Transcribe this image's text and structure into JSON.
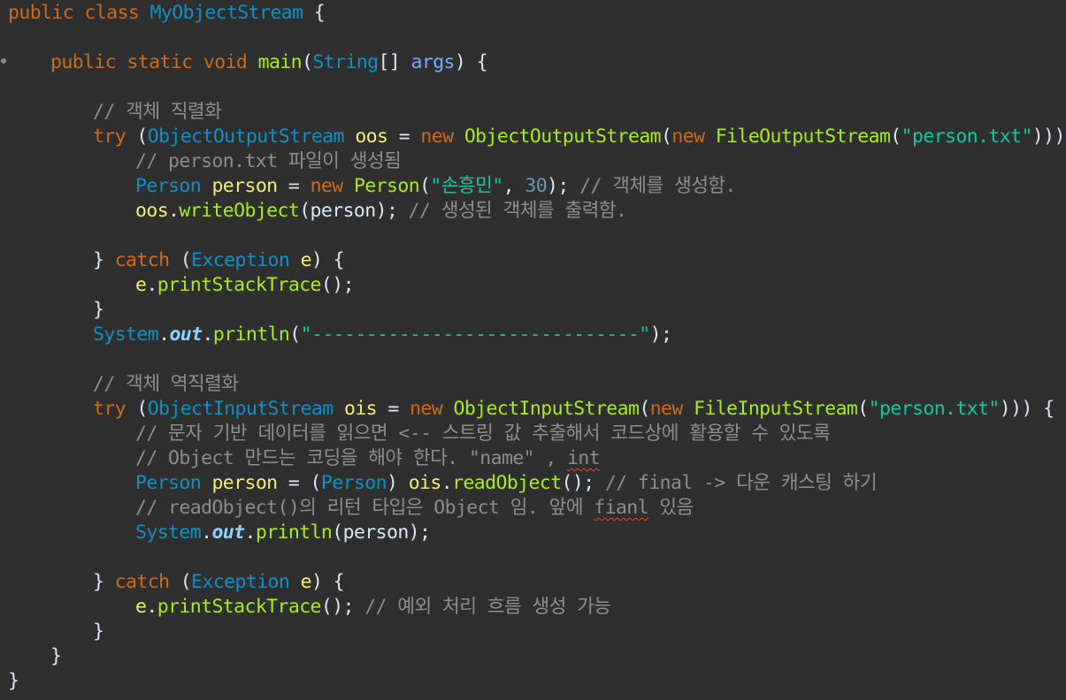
{
  "editor": {
    "lines": [
      {
        "indent": 0,
        "tokens": [
          {
            "t": "public",
            "c": "kw"
          },
          {
            "t": " ",
            "c": "plain"
          },
          {
            "t": "class",
            "c": "kw"
          },
          {
            "t": " ",
            "c": "plain"
          },
          {
            "t": "MyObjectStream",
            "c": "cls"
          },
          {
            "t": " {",
            "c": "plain"
          }
        ]
      },
      {
        "indent": 0,
        "tokens": []
      },
      {
        "indent": 1,
        "tokens": [
          {
            "t": "public",
            "c": "kw"
          },
          {
            "t": " ",
            "c": "plain"
          },
          {
            "t": "static",
            "c": "kw"
          },
          {
            "t": " ",
            "c": "plain"
          },
          {
            "t": "void",
            "c": "kw"
          },
          {
            "t": " ",
            "c": "plain"
          },
          {
            "t": "main",
            "c": "method"
          },
          {
            "t": "(",
            "c": "plain"
          },
          {
            "t": "String",
            "c": "cls"
          },
          {
            "t": "[] ",
            "c": "plain"
          },
          {
            "t": "args",
            "c": "param"
          },
          {
            "t": ") {",
            "c": "plain"
          }
        ]
      },
      {
        "indent": 0,
        "tokens": []
      },
      {
        "indent": 2,
        "tokens": [
          {
            "t": "// 객체 직렬화",
            "c": "com"
          }
        ]
      },
      {
        "indent": 2,
        "tokens": [
          {
            "t": "try",
            "c": "kw"
          },
          {
            "t": " (",
            "c": "plain"
          },
          {
            "t": "ObjectOutputStream",
            "c": "cls"
          },
          {
            "t": " ",
            "c": "plain"
          },
          {
            "t": "oos",
            "c": "var"
          },
          {
            "t": " = ",
            "c": "plain"
          },
          {
            "t": "new",
            "c": "kw"
          },
          {
            "t": " ",
            "c": "plain"
          },
          {
            "t": "ObjectOutputStream",
            "c": "method"
          },
          {
            "t": "(",
            "c": "plain"
          },
          {
            "t": "new",
            "c": "kw"
          },
          {
            "t": " ",
            "c": "plain"
          },
          {
            "t": "FileOutputStream",
            "c": "method"
          },
          {
            "t": "(",
            "c": "plain"
          },
          {
            "t": "\"person.txt\"",
            "c": "str"
          },
          {
            "t": "))) {",
            "c": "plain"
          }
        ]
      },
      {
        "indent": 3,
        "tokens": [
          {
            "t": "// person.txt 파일이 생성됨",
            "c": "com"
          }
        ]
      },
      {
        "indent": 3,
        "tokens": [
          {
            "t": "Person",
            "c": "cls"
          },
          {
            "t": " ",
            "c": "plain"
          },
          {
            "t": "person",
            "c": "var"
          },
          {
            "t": " = ",
            "c": "plain"
          },
          {
            "t": "new",
            "c": "kw"
          },
          {
            "t": " ",
            "c": "plain"
          },
          {
            "t": "Person",
            "c": "method"
          },
          {
            "t": "(",
            "c": "plain"
          },
          {
            "t": "\"손흥민\"",
            "c": "str"
          },
          {
            "t": ", ",
            "c": "plain"
          },
          {
            "t": "30",
            "c": "num"
          },
          {
            "t": "); ",
            "c": "plain"
          },
          {
            "t": "// 객체를 생성함.",
            "c": "com"
          }
        ]
      },
      {
        "indent": 3,
        "tokens": [
          {
            "t": "oos",
            "c": "var"
          },
          {
            "t": ".",
            "c": "plain"
          },
          {
            "t": "writeObject",
            "c": "method"
          },
          {
            "t": "(person); ",
            "c": "plain"
          },
          {
            "t": "// 생성된 객체를 출력함.",
            "c": "com"
          }
        ]
      },
      {
        "indent": 0,
        "tokens": []
      },
      {
        "indent": 2,
        "tokens": [
          {
            "t": "} ",
            "c": "plain"
          },
          {
            "t": "catch",
            "c": "kw"
          },
          {
            "t": " (",
            "c": "plain"
          },
          {
            "t": "Exception",
            "c": "cls"
          },
          {
            "t": " ",
            "c": "plain"
          },
          {
            "t": "e",
            "c": "var"
          },
          {
            "t": ") {",
            "c": "plain"
          }
        ]
      },
      {
        "indent": 3,
        "tokens": [
          {
            "t": "e",
            "c": "var"
          },
          {
            "t": ".",
            "c": "plain"
          },
          {
            "t": "printStackTrace",
            "c": "method"
          },
          {
            "t": "();",
            "c": "plain"
          }
        ]
      },
      {
        "indent": 2,
        "tokens": [
          {
            "t": "}",
            "c": "plain"
          }
        ]
      },
      {
        "indent": 2,
        "tokens": [
          {
            "t": "System",
            "c": "cls"
          },
          {
            "t": ".",
            "c": "plain"
          },
          {
            "t": "out",
            "c": "field"
          },
          {
            "t": ".",
            "c": "plain"
          },
          {
            "t": "println",
            "c": "method"
          },
          {
            "t": "(",
            "c": "plain"
          },
          {
            "t": "\"------------------------------\"",
            "c": "str"
          },
          {
            "t": ");",
            "c": "plain"
          }
        ]
      },
      {
        "indent": 0,
        "tokens": []
      },
      {
        "indent": 2,
        "tokens": [
          {
            "t": "// 객체 역직렬화",
            "c": "com"
          }
        ]
      },
      {
        "indent": 2,
        "tokens": [
          {
            "t": "try",
            "c": "kw"
          },
          {
            "t": " (",
            "c": "plain"
          },
          {
            "t": "ObjectInputStream",
            "c": "cls"
          },
          {
            "t": " ",
            "c": "plain"
          },
          {
            "t": "ois",
            "c": "var"
          },
          {
            "t": " = ",
            "c": "plain"
          },
          {
            "t": "new",
            "c": "kw"
          },
          {
            "t": " ",
            "c": "plain"
          },
          {
            "t": "ObjectInputStream",
            "c": "method"
          },
          {
            "t": "(",
            "c": "plain"
          },
          {
            "t": "new",
            "c": "kw"
          },
          {
            "t": " ",
            "c": "plain"
          },
          {
            "t": "FileInputStream",
            "c": "method"
          },
          {
            "t": "(",
            "c": "plain"
          },
          {
            "t": "\"person.txt\"",
            "c": "str"
          },
          {
            "t": "))) {",
            "c": "plain"
          }
        ]
      },
      {
        "indent": 3,
        "tokens": [
          {
            "t": "// 문자 기반 데이터를 읽으면 <-- 스트링 값 추출해서 코드상에 활용할 수 있도록",
            "c": "com"
          }
        ]
      },
      {
        "indent": 3,
        "tokens": [
          {
            "t": "// Object 만드는 코딩을 해야 한다. \"name\" , ",
            "c": "com"
          },
          {
            "t": "int",
            "c": "com",
            "squiggle": true
          }
        ]
      },
      {
        "indent": 3,
        "tokens": [
          {
            "t": "Person",
            "c": "cls"
          },
          {
            "t": " ",
            "c": "plain"
          },
          {
            "t": "person",
            "c": "var"
          },
          {
            "t": " = (",
            "c": "plain"
          },
          {
            "t": "Person",
            "c": "cls"
          },
          {
            "t": ") ",
            "c": "plain"
          },
          {
            "t": "ois",
            "c": "var"
          },
          {
            "t": ".",
            "c": "plain"
          },
          {
            "t": "readObject",
            "c": "method"
          },
          {
            "t": "(); ",
            "c": "plain"
          },
          {
            "t": "// final -> 다운 캐스팅 하기",
            "c": "com"
          }
        ]
      },
      {
        "indent": 3,
        "tokens": [
          {
            "t": "// readObject()의 리턴 타입은 Object 임. 앞에 ",
            "c": "com"
          },
          {
            "t": "fianl",
            "c": "com",
            "squiggle": true
          },
          {
            "t": " 있음",
            "c": "com"
          }
        ]
      },
      {
        "indent": 3,
        "tokens": [
          {
            "t": "System",
            "c": "cls"
          },
          {
            "t": ".",
            "c": "plain"
          },
          {
            "t": "out",
            "c": "field"
          },
          {
            "t": ".",
            "c": "plain"
          },
          {
            "t": "println",
            "c": "method"
          },
          {
            "t": "(person);",
            "c": "plain"
          }
        ]
      },
      {
        "indent": 0,
        "tokens": []
      },
      {
        "indent": 2,
        "tokens": [
          {
            "t": "} ",
            "c": "plain"
          },
          {
            "t": "catch",
            "c": "kw"
          },
          {
            "t": " (",
            "c": "plain"
          },
          {
            "t": "Exception",
            "c": "cls"
          },
          {
            "t": " ",
            "c": "plain"
          },
          {
            "t": "e",
            "c": "var"
          },
          {
            "t": ") {",
            "c": "plain"
          }
        ]
      },
      {
        "indent": 3,
        "tokens": [
          {
            "t": "e",
            "c": "var"
          },
          {
            "t": ".",
            "c": "plain"
          },
          {
            "t": "printStackTrace",
            "c": "method"
          },
          {
            "t": "(); ",
            "c": "plain"
          },
          {
            "t": "// 예외 처리 흐름 생성 가능",
            "c": "com"
          }
        ]
      },
      {
        "indent": 2,
        "tokens": [
          {
            "t": "}",
            "c": "plain"
          }
        ]
      },
      {
        "indent": 1,
        "tokens": [
          {
            "t": "}",
            "c": "plain"
          }
        ]
      },
      {
        "indent": 0,
        "tokens": [
          {
            "t": "}",
            "c": "plain"
          }
        ]
      }
    ]
  },
  "colors": {
    "background": "#2f2f2f",
    "keyword": "#cc6c1d",
    "class": "#1290c3",
    "method": "#a7ec21",
    "variable": "#f3ec79",
    "parameter": "#79abff",
    "string": "#17c6a3",
    "number": "#6897bb",
    "comment": "#8d8d8d",
    "text": "#d9e8f7"
  }
}
